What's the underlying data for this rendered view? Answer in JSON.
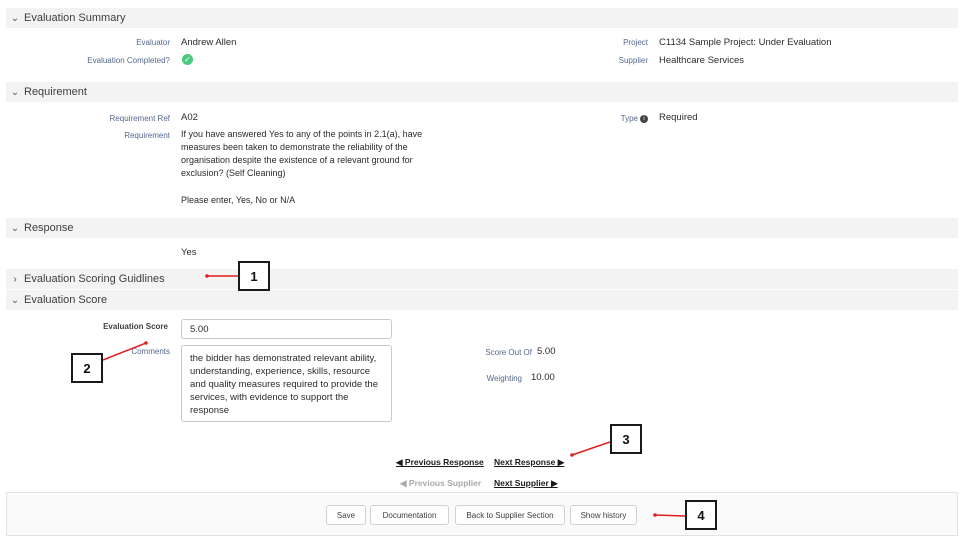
{
  "sections": {
    "summary": {
      "title": "Evaluation Summary",
      "chevron": "chevron-down-icon"
    },
    "requirement": {
      "title": "Requirement",
      "chevron": "chevron-down-icon"
    },
    "response": {
      "title": "Response",
      "chevron": "chevron-down-icon"
    },
    "guidelines": {
      "title": "Evaluation Scoring Guidlines",
      "chevron": "chevron-right-icon"
    },
    "score": {
      "title": "Evaluation Score",
      "chevron": "chevron-down-icon"
    }
  },
  "summary": {
    "evaluator_label": "Evaluator",
    "evaluator_value": "Andrew Allen",
    "completed_label": "Evaluation Completed?",
    "project_label": "Project",
    "project_value": "C1134 Sample Project: Under Evaluation",
    "supplier_label": "Supplier",
    "supplier_value": "Healthcare Services"
  },
  "requirement": {
    "ref_label": "Requirement Ref",
    "ref_value": "A02",
    "req_label": "Requirement",
    "req_text": "If you have answered Yes to any of the points in 2.1(a), have measures been taken to demonstrate the reliability of the organisation despite the existence of a relevant ground for exclusion? (Self Cleaning)",
    "req_note": "Please enter, Yes, No or N/A",
    "type_label": "Type",
    "type_value": "Required"
  },
  "response": {
    "value": "Yes"
  },
  "score": {
    "score_label": "Evaluation Score",
    "score_value": "5.00",
    "comments_label": "Comments",
    "comments_value": "the bidder has demonstrated relevant ability, understanding, experience, skills, resource and quality measures required to provide the services, with evidence to support the response",
    "out_of_label": "Score Out Of",
    "out_of_value": "5.00",
    "weighting_label": "Weighting",
    "weighting_value": "10.00"
  },
  "nav": {
    "prev_response": "◀ Previous Response",
    "next_response": "Next Response ▶",
    "prev_supplier": "◀ Previous Supplier",
    "next_supplier": "Next Supplier ▶"
  },
  "footer": {
    "save": "Save",
    "documentation": "Documentation",
    "back": "Back to Supplier Section",
    "history": "Show history"
  },
  "callouts": {
    "c1": "1",
    "c2": "2",
    "c3": "3",
    "c4": "4"
  },
  "colors": {
    "accent": "#4bca81",
    "callout_line": "#e02020",
    "header_bg": "#f3f3f3"
  }
}
